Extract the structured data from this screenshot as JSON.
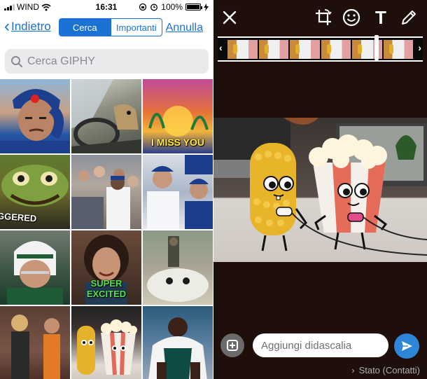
{
  "status_bar": {
    "carrier": "WIND",
    "time": "16:31",
    "battery_percent": "100%",
    "battery_level": 1.0
  },
  "nav": {
    "back_label": "Indietro",
    "segments": [
      {
        "label": "Cerca",
        "active": true
      },
      {
        "label": "Importanti",
        "active": false
      }
    ],
    "cancel_label": "Annulla"
  },
  "search": {
    "placeholder": "Cerca GIPHY"
  },
  "gif_grid": [
    {
      "caption": ""
    },
    {
      "caption": ""
    },
    {
      "caption": "I MISS YOU"
    },
    {
      "caption": "GGERED"
    },
    {
      "caption": ""
    },
    {
      "caption": ""
    },
    {
      "caption": ""
    },
    {
      "caption": "SUPER EXCITED"
    },
    {
      "caption": ""
    },
    {
      "caption": ""
    },
    {
      "caption": ""
    },
    {
      "caption": ""
    }
  ],
  "editor": {
    "tools": [
      "close-icon",
      "crop-rotate-icon",
      "emoji-icon",
      "text-icon",
      "pencil-icon"
    ],
    "text_tool_label": "T",
    "caption_placeholder": "Aggiungi didascalia",
    "status_label": "Stato (Contatti)",
    "accent_color": "#2f86d8"
  }
}
